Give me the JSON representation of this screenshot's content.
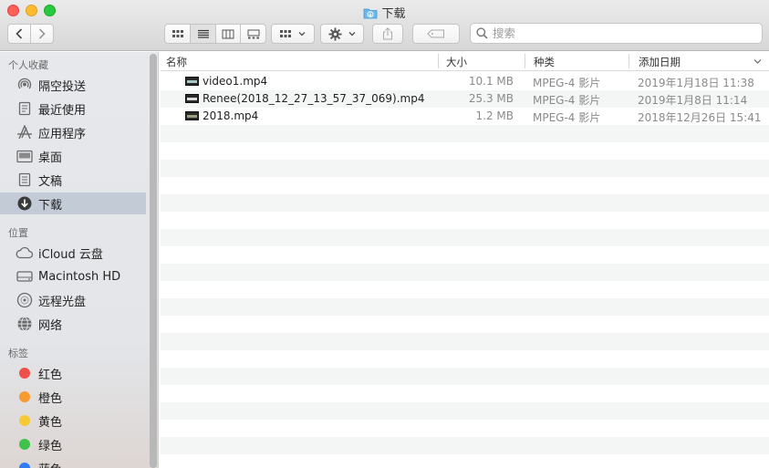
{
  "window": {
    "title": "下载"
  },
  "search": {
    "placeholder": "搜索"
  },
  "sidebar": {
    "favorites_header": "个人收藏",
    "favorites": [
      {
        "label": "隔空投送",
        "icon": "airdrop-icon"
      },
      {
        "label": "最近使用",
        "icon": "recents-icon"
      },
      {
        "label": "应用程序",
        "icon": "applications-icon"
      },
      {
        "label": "桌面",
        "icon": "desktop-icon"
      },
      {
        "label": "文稿",
        "icon": "documents-icon"
      },
      {
        "label": "下载",
        "icon": "downloads-icon",
        "selected": true
      }
    ],
    "locations_header": "位置",
    "locations": [
      {
        "label": "iCloud 云盘",
        "icon": "icloud-icon"
      },
      {
        "label": "Macintosh HD",
        "icon": "hard-disk-icon"
      },
      {
        "label": "远程光盘",
        "icon": "remote-disc-icon"
      },
      {
        "label": "网络",
        "icon": "network-icon"
      }
    ],
    "tags_header": "标签",
    "tags": [
      {
        "label": "红色",
        "color": "#f0504a"
      },
      {
        "label": "橙色",
        "color": "#f79a30"
      },
      {
        "label": "黄色",
        "color": "#f7c935"
      },
      {
        "label": "绿色",
        "color": "#3ec24b"
      },
      {
        "label": "蓝色",
        "color": "#2f7cf6"
      }
    ]
  },
  "columns": {
    "name": "名称",
    "size": "大小",
    "kind": "种类",
    "date_added": "添加日期"
  },
  "files": [
    {
      "name": "video1.mp4",
      "size": "10.1 MB",
      "kind": "MPEG-4 影片",
      "date_added": "2019年1月18日 11:38"
    },
    {
      "name": "Renee(2018_12_27_13_57_37_069).mp4",
      "size": "25.3 MB",
      "kind": "MPEG-4 影片",
      "date_added": "2019年1月8日 11:14"
    },
    {
      "name": "2018.mp4",
      "size": "1.2 MB",
      "kind": "MPEG-4 影片",
      "date_added": "2018年12月26日 15:41"
    }
  ],
  "colors": {
    "selection": "#c3cbd7",
    "folder_accent": "#4aa3df"
  }
}
